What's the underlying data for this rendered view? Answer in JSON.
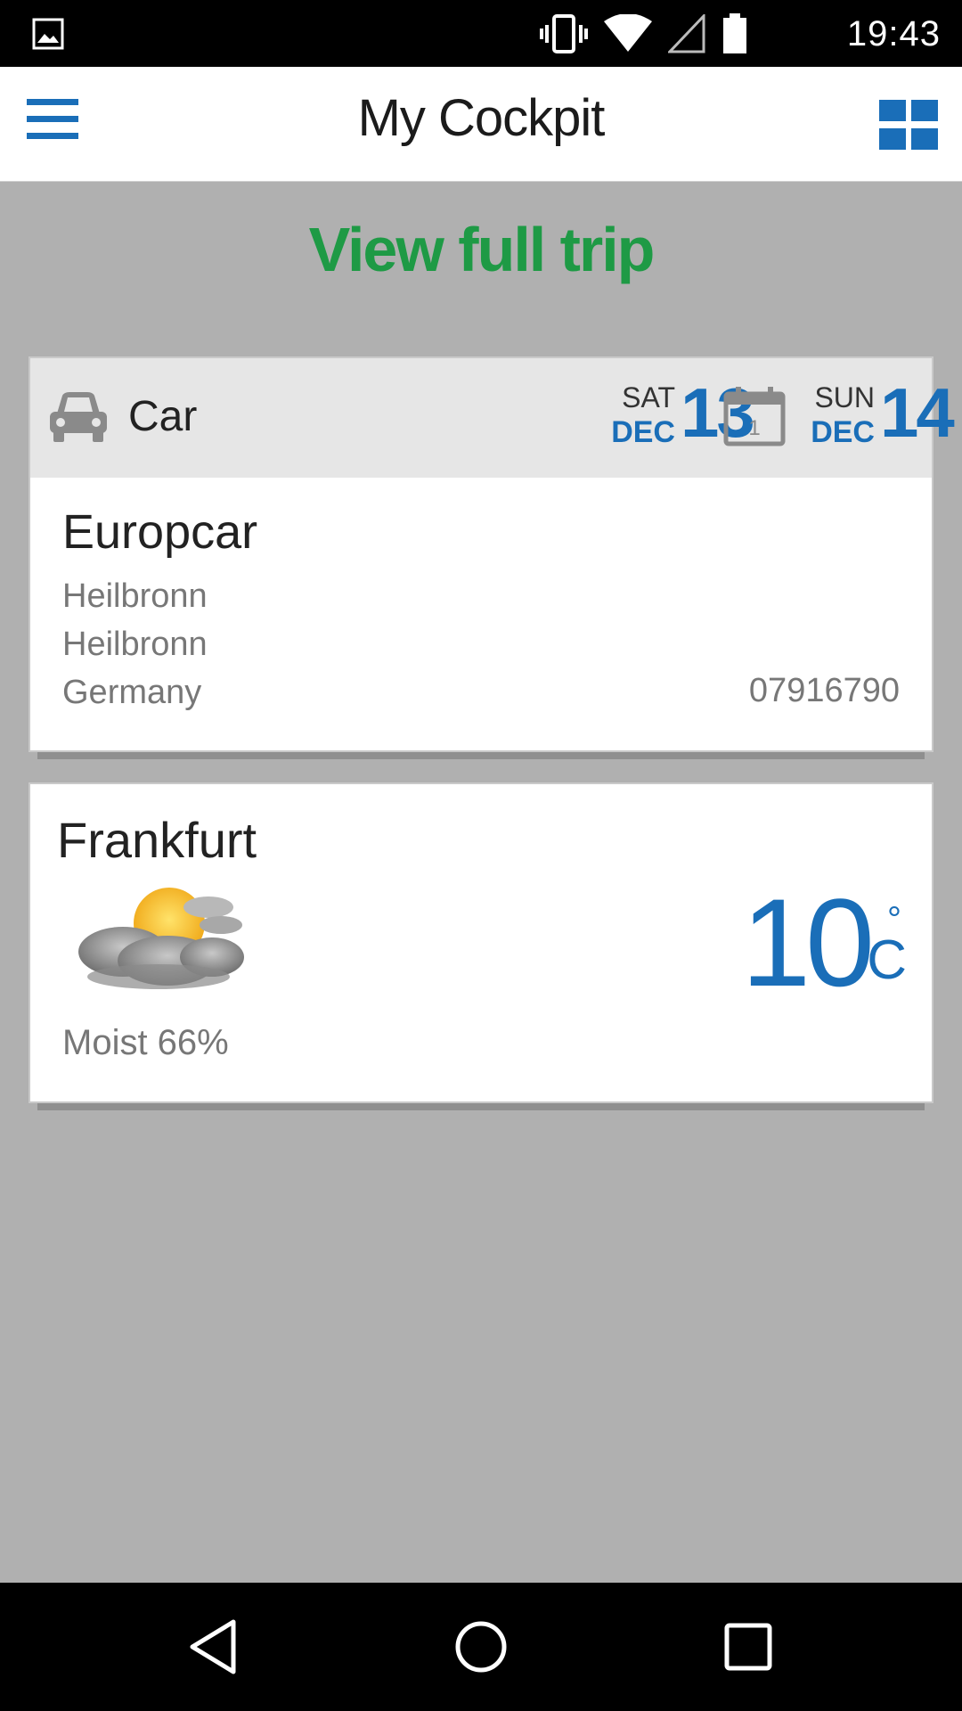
{
  "status_bar": {
    "time": "19:43",
    "icons": [
      "gallery-icon",
      "vibrate-icon",
      "wifi-icon",
      "signal-icon",
      "battery-icon"
    ]
  },
  "app_bar": {
    "title": "My Cockpit",
    "left_icon": "menu-icon",
    "right_icon": "grid-view-icon"
  },
  "view_full_trip_label": "View full trip",
  "car_booking": {
    "type_label": "Car",
    "pickup": {
      "day_of_week": "SAT",
      "month": "DEC",
      "day": "13"
    },
    "calendar_icon_day": "1",
    "dropoff": {
      "day_of_week": "SUN",
      "month": "DEC",
      "day": "14"
    },
    "company": "Europcar",
    "address_lines": [
      "Heilbronn",
      "Heilbronn",
      "Germany"
    ],
    "phone": "07916790"
  },
  "weather": {
    "city": "Frankfurt",
    "condition_icon": "partly-cloudy-icon",
    "humidity_label": "Moist 66%",
    "temperature": "10",
    "degree_symbol": "°",
    "unit": "C"
  },
  "colors": {
    "accent_blue": "#1a6eb8",
    "trip_green": "#1e9a45",
    "background_gray": "#b0b0b0"
  }
}
